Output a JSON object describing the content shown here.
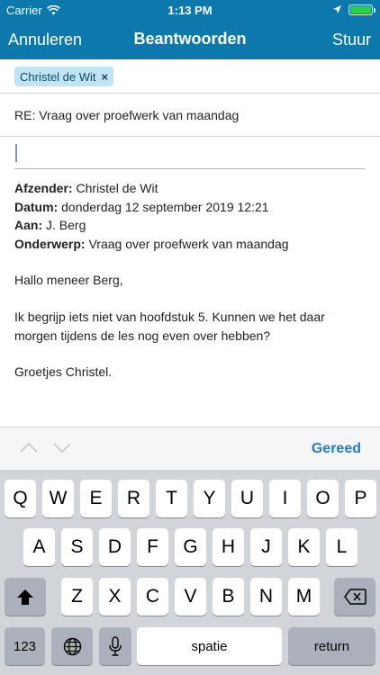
{
  "status_bar": {
    "carrier": "Carrier",
    "time": "1:13 PM"
  },
  "nav": {
    "cancel_label": "Annuleren",
    "title": "Beantwoorden",
    "send_label": "Stuur"
  },
  "recipient": {
    "name": "Christel de Wit",
    "remove_glyph": "×"
  },
  "subject": "RE: Vraag over proefwerk van maandag",
  "quoted": {
    "from_label": "Afzender:",
    "from_value": "Christel de Wit",
    "date_label": "Datum:",
    "date_value": "donderdag 12 september 2019 12:21",
    "to_label": "Aan:",
    "to_value": "J. Berg",
    "subject_label": "Onderwerp:",
    "subject_value": "Vraag over proefwerk van maandag",
    "greeting": "Hallo meneer Berg,",
    "body_line1": "Ik begrijp iets niet van hoofdstuk 5. Kunnen we het daar",
    "body_line2": "morgen tijdens de les nog even over hebben?",
    "closing": "Groetjes Christel."
  },
  "accessory": {
    "done_label": "Gereed"
  },
  "keyboard": {
    "row1": [
      "Q",
      "W",
      "E",
      "R",
      "T",
      "Y",
      "U",
      "I",
      "O",
      "P"
    ],
    "row2": [
      "A",
      "S",
      "D",
      "F",
      "G",
      "H",
      "J",
      "K",
      "L"
    ],
    "row3": [
      "Z",
      "X",
      "C",
      "V",
      "B",
      "N",
      "M"
    ],
    "numbers_label": "123",
    "space_label": "spatie",
    "return_label": "return"
  },
  "colors": {
    "accent": "#0d78ab",
    "done": "#1e7bd6",
    "chip_bg": "#bfe4f3",
    "keyboard_bg": "#d1d4d9"
  }
}
